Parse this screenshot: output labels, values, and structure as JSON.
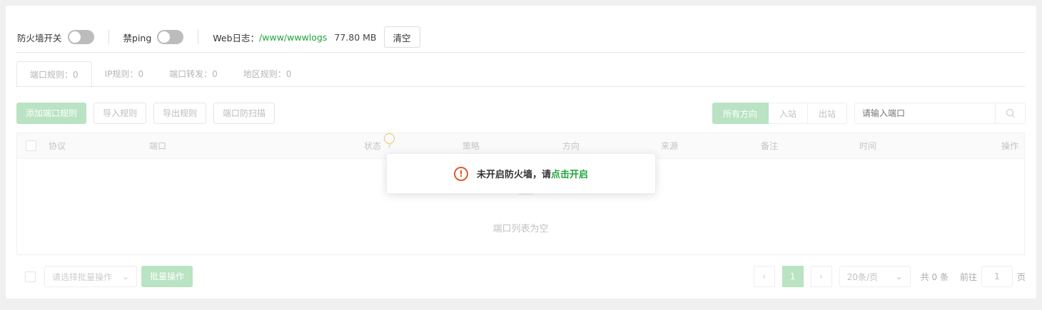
{
  "topbar": {
    "firewall_label": "防火墙开关",
    "firewall_on": false,
    "ping_label": "禁ping",
    "ping_on": false,
    "weblog_label": "Web日志：",
    "weblog_path": "/www/wwwlogs",
    "weblog_size": "77.80 MB",
    "clear_label": "清空"
  },
  "tabs": [
    {
      "label": "端口规则：0"
    },
    {
      "label": "IP规则：0"
    },
    {
      "label": "端口转发：0"
    },
    {
      "label": "地区规则：0"
    }
  ],
  "toolbar": {
    "add_label": "添加端口规则",
    "import_label": "导入规则",
    "export_label": "导出规则",
    "scan_label": "端口防扫描",
    "directions": [
      "所有方向",
      "入站",
      "出站"
    ],
    "search_placeholder": "请输入端口"
  },
  "table": {
    "columns": [
      "协议",
      "端口",
      "状态",
      "策略",
      "方向",
      "来源",
      "备注",
      "时间",
      "操作"
    ],
    "empty_text": "端口列表为空"
  },
  "footer": {
    "batch_placeholder": "请选择批量操作",
    "batch_button": "批量操作",
    "current_page": "1",
    "page_size": "20条/页",
    "total": "共 0 条",
    "goto_label": "前往",
    "goto_value": "1",
    "page_unit": "页"
  },
  "toast": {
    "message": "未开启防火墙，请",
    "link": "点击开启"
  },
  "colors": {
    "accent": "#20a53a",
    "accent_light": "#b9e3c2",
    "warning": "#e05a2b"
  }
}
